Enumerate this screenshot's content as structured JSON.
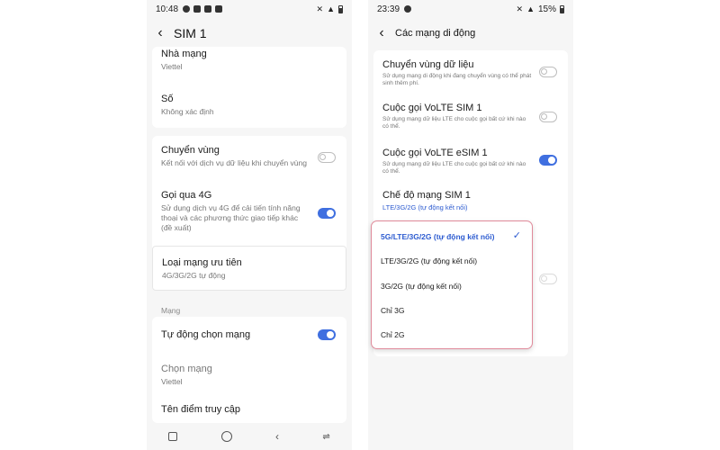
{
  "screen1": {
    "status": {
      "time": "10:48",
      "battery": ""
    },
    "title": "SIM 1",
    "carrier": {
      "label": "Nhà mạng",
      "value": "Viettel"
    },
    "number": {
      "label": "Số",
      "value": "Không xác định"
    },
    "roaming": {
      "label": "Chuyển vùng",
      "desc": "Kết nối với dịch vụ dữ liệu khi chuyển vùng",
      "on": false
    },
    "call4g": {
      "label": "Gọi qua 4G",
      "desc": "Sử dụng dịch vụ 4G để cải tiến tính năng thoại và các phương thức giao tiếp khác (đề xuất)",
      "on": true
    },
    "preferred_network": {
      "label": "Loại mạng ưu tiên",
      "value": "4G/3G/2G tự động"
    },
    "network_section": "Mạng",
    "auto_select": {
      "label": "Tự động chọn mạng",
      "on": true
    },
    "choose_network": {
      "label": "Chọn mạng",
      "value": "Viettel"
    },
    "apn": {
      "label": "Tên điểm truy cập"
    }
  },
  "screen2": {
    "status": {
      "time": "23:39",
      "battery": "15%"
    },
    "title": "Các mạng di động",
    "data_roaming": {
      "label": "Chuyển vùng dữ liệu",
      "desc": "Sử dụng mạng di động khi đang chuyển vùng có thể phát sinh thêm phí.",
      "on": false
    },
    "volte_sim1": {
      "label": "Cuộc gọi VoLTE SIM 1",
      "desc": "Sử dụng mạng dữ liệu LTE cho cuộc gọi bất cứ khi nào có thể.",
      "on": false
    },
    "volte_esim1": {
      "label": "Cuộc gọi VoLTE eSIM 1",
      "desc": "Sử dụng mạng dữ liệu LTE cho cuộc gọi bất cứ khi nào có thể.",
      "on": true
    },
    "network_mode": {
      "label": "Chế độ mạng SIM 1",
      "value": "LTE/3G/2G (tự động kết nối)"
    },
    "options": [
      "5G/LTE/3G/2G (tự động kết nối)",
      "LTE/3G/2G (tự động kết nối)",
      "3G/2G (tự động kết nối)",
      "Chỉ 3G",
      "Chỉ 2G"
    ],
    "selected_option": "5G/LTE/3G/2G (tự động kết nối)"
  },
  "icons": {
    "back": "back-arrow-icon",
    "check": "checkmark-icon",
    "nav": [
      "recents-icon",
      "home-icon",
      "back-icon",
      "switch-icon"
    ]
  },
  "colors": {
    "accent": "#3f6fe0",
    "popup_border": "#e08a9a",
    "background": "#f6f6f6"
  }
}
